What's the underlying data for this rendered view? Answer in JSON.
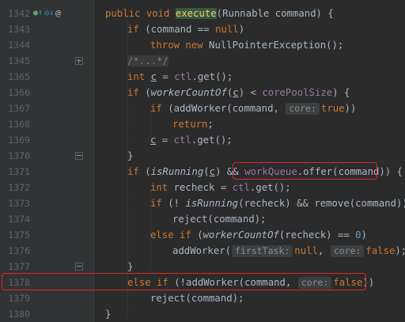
{
  "editor": {
    "lines": [
      {
        "num": "1342",
        "indent": 0,
        "tokens": [
          [
            "public void ",
            "kw"
          ],
          [
            "execute",
            "fn-hl"
          ],
          [
            "(Runnable command) {",
            ""
          ]
        ],
        "gutter_icons": true
      },
      {
        "num": "1343",
        "indent": 1,
        "tokens": [
          [
            "if ",
            "kw"
          ],
          [
            "(command == ",
            ""
          ],
          [
            "null",
            "kw"
          ],
          [
            ")",
            ""
          ]
        ]
      },
      {
        "num": "1344",
        "indent": 2,
        "tokens": [
          [
            "throw new ",
            "kw"
          ],
          [
            "NullPointerException();",
            ""
          ]
        ]
      },
      {
        "num": "1345",
        "indent": 1,
        "tokens": [
          [
            "/*...*/",
            "fold-text"
          ]
        ],
        "fold": "plus"
      },
      {
        "num": "1365",
        "indent": 1,
        "tokens": [
          [
            "int ",
            "kw"
          ],
          [
            "c",
            "ul"
          ],
          [
            " = ",
            ""
          ],
          [
            "ctl",
            "fld"
          ],
          [
            ".get();",
            ""
          ]
        ]
      },
      {
        "num": "1366",
        "indent": 1,
        "tokens": [
          [
            "if ",
            "kw"
          ],
          [
            "(",
            ""
          ],
          [
            "workerCountOf",
            "it"
          ],
          [
            "(",
            ""
          ],
          [
            "c",
            "ul"
          ],
          [
            ") < ",
            ""
          ],
          [
            "corePoolSize",
            "fld"
          ],
          [
            ") {",
            ""
          ]
        ]
      },
      {
        "num": "1367",
        "indent": 2,
        "tokens": [
          [
            "if ",
            "kw"
          ],
          [
            "(addWorker(command, ",
            ""
          ],
          [
            "HINT:core:",
            "hint"
          ],
          [
            "true",
            "kw"
          ],
          [
            "))",
            ""
          ]
        ]
      },
      {
        "num": "1368",
        "indent": 3,
        "tokens": [
          [
            "return",
            "kw"
          ],
          [
            ";",
            ""
          ]
        ]
      },
      {
        "num": "1369",
        "indent": 2,
        "tokens": [
          [
            "c",
            "ul"
          ],
          [
            " = ",
            ""
          ],
          [
            "ctl",
            "fld"
          ],
          [
            ".get();",
            ""
          ]
        ]
      },
      {
        "num": "1370",
        "indent": 1,
        "tokens": [
          [
            "}",
            ""
          ]
        ],
        "fold": "minus"
      },
      {
        "num": "1371",
        "indent": 1,
        "tokens": [
          [
            "if ",
            "kw"
          ],
          [
            "(",
            ""
          ],
          [
            "isRunning",
            "it"
          ],
          [
            "(",
            ""
          ],
          [
            "c",
            "ul"
          ],
          [
            ") && ",
            ""
          ],
          [
            "workQueue",
            "fld"
          ],
          [
            ".offer(command)) {",
            ""
          ]
        ]
      },
      {
        "num": "1372",
        "indent": 2,
        "tokens": [
          [
            "int ",
            "kw"
          ],
          [
            "recheck = ",
            ""
          ],
          [
            "ctl",
            "fld"
          ],
          [
            ".get();",
            ""
          ]
        ]
      },
      {
        "num": "1373",
        "indent": 2,
        "tokens": [
          [
            "if ",
            "kw"
          ],
          [
            "(! ",
            ""
          ],
          [
            "isRunning",
            "it"
          ],
          [
            "(recheck) && remove(command))",
            ""
          ]
        ]
      },
      {
        "num": "1374",
        "indent": 3,
        "tokens": [
          [
            "reject(command);",
            ""
          ]
        ]
      },
      {
        "num": "1375",
        "indent": 2,
        "tokens": [
          [
            "else if ",
            "kw"
          ],
          [
            "(",
            ""
          ],
          [
            "workerCountOf",
            "it"
          ],
          [
            "(recheck) == ",
            ""
          ],
          [
            "0",
            "num"
          ],
          [
            ")",
            ""
          ]
        ]
      },
      {
        "num": "1376",
        "indent": 3,
        "tokens": [
          [
            "addWorker(",
            ""
          ],
          [
            "HINT:firstTask:",
            "hint"
          ],
          [
            "null",
            "kw"
          ],
          [
            ", ",
            ""
          ],
          [
            "HINT:core:",
            "hint"
          ],
          [
            "false",
            "kw"
          ],
          [
            ");",
            ""
          ]
        ]
      },
      {
        "num": "1377",
        "indent": 1,
        "tokens": [
          [
            "}",
            ""
          ]
        ],
        "fold": "minus"
      },
      {
        "num": "1378",
        "indent": 1,
        "tokens": [
          [
            "else if ",
            "kw"
          ],
          [
            "(!addWorker(command, ",
            ""
          ],
          [
            "HINT:core:",
            "hint"
          ],
          [
            "false",
            "kw"
          ],
          [
            "))",
            ""
          ]
        ]
      },
      {
        "num": "1379",
        "indent": 2,
        "tokens": [
          [
            "reject(command);",
            ""
          ]
        ]
      },
      {
        "num": "1380",
        "indent": 0,
        "tokens": [
          [
            "}",
            ""
          ]
        ]
      }
    ],
    "colors": {
      "background": "#2b2b2b",
      "gutter": "#313335",
      "keyword": "#cc7832",
      "method_decl": "#ffc66d",
      "field": "#9876aa",
      "number": "#6897bb",
      "highlight_box": "#e0282a"
    },
    "gutter_icon_names": [
      "overrides-method-icon",
      "implements-method-icon",
      "annotation-at-icon"
    ]
  }
}
